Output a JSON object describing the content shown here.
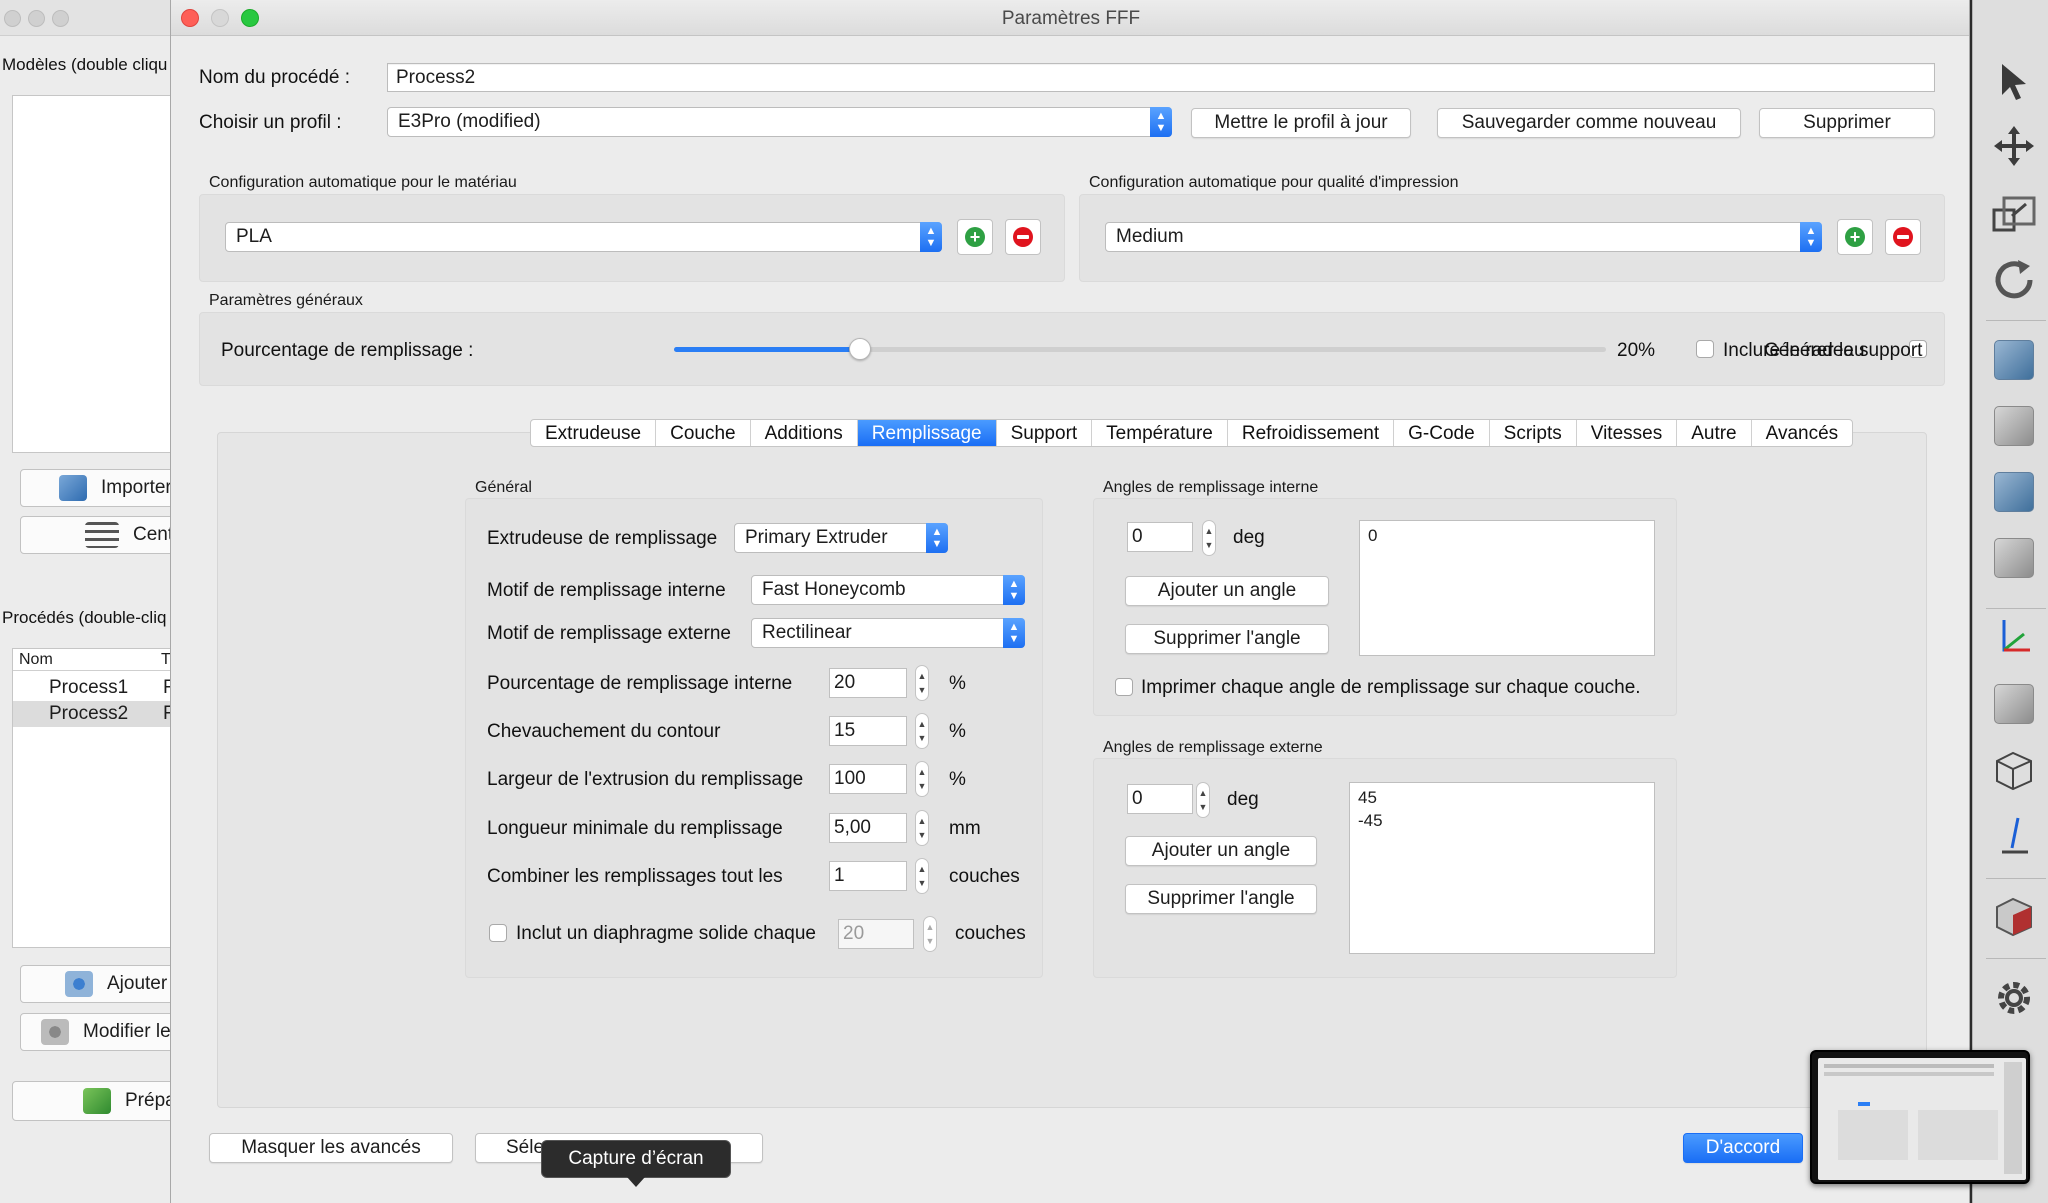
{
  "background_window": {
    "models_label": "Modèles (double cliqu",
    "import_button": "Importer",
    "center_button": "Cent",
    "processes_label": "Procédés (double-cliq",
    "table_header_name": "Nom",
    "table_header_type": "T",
    "processes": [
      {
        "name": "Process1",
        "type": "F"
      },
      {
        "name": "Process2",
        "type": "F"
      }
    ],
    "add_button": "Ajouter",
    "modify_button": "Modifier le",
    "prepare_button": "Prépa"
  },
  "dialog": {
    "title": "Paramètres FFF",
    "process_name_label": "Nom du procédé :",
    "process_name_value": "Process2",
    "profile_label": "Choisir un profil :",
    "profile_value": "E3Pro (modified)",
    "update_profile_button": "Mettre le profil à jour",
    "save_new_button": "Sauvegarder comme nouveau",
    "delete_button": "Supprimer",
    "material_group_label": "Configuration automatique pour le matériau",
    "material_value": "PLA",
    "quality_group_label": "Configuration automatique pour qualité d'impression",
    "quality_value": "Medium",
    "general_settings_label": "Paramètres généraux",
    "infill_percentage_label": "Pourcentage de remplissage :",
    "infill_percentage_value": "20%",
    "infill_slider_fraction": 0.2,
    "include_raft_label": "Inclure le radeau",
    "generate_support_label": "Générer le support",
    "tabs": [
      {
        "label": "Extrudeuse",
        "active": false
      },
      {
        "label": "Couche",
        "active": false
      },
      {
        "label": "Additions",
        "active": false
      },
      {
        "label": "Remplissage",
        "active": true
      },
      {
        "label": "Support",
        "active": false
      },
      {
        "label": "Température",
        "active": false
      },
      {
        "label": "Refroidissement",
        "active": false
      },
      {
        "label": "G-Code",
        "active": false
      },
      {
        "label": "Scripts",
        "active": false
      },
      {
        "label": "Vitesses",
        "active": false
      },
      {
        "label": "Autre",
        "active": false
      },
      {
        "label": "Avancés",
        "active": false
      }
    ],
    "general_group": {
      "label": "Général",
      "infill_extruder_label": "Extrudeuse de remplissage",
      "infill_extruder_value": "Primary Extruder",
      "internal_pattern_label": "Motif de remplissage interne",
      "internal_pattern_value": "Fast Honeycomb",
      "external_pattern_label": "Motif de remplissage externe",
      "external_pattern_value": "Rectilinear",
      "rows": [
        {
          "label": "Pourcentage de remplissage interne",
          "value": "20",
          "unit": "%"
        },
        {
          "label": "Chevauchement du contour",
          "value": "15",
          "unit": "%"
        },
        {
          "label": "Largeur de l'extrusion du remplissage",
          "value": "100",
          "unit": "%"
        },
        {
          "label": "Longueur minimale du remplissage",
          "value": "5,00",
          "unit": "mm"
        },
        {
          "label": "Combiner les remplissages tout les",
          "value": "1",
          "unit": "couches"
        }
      ],
      "solid_diaphragm_label": "Inclut un diaphragme solide chaque",
      "solid_diaphragm_value": "20",
      "solid_diaphragm_unit": "couches"
    },
    "internal_angles": {
      "label": "Angles de remplissage interne",
      "angle_value": "0",
      "unit": "deg",
      "add_button": "Ajouter un angle",
      "remove_button": "Supprimer l'angle",
      "angles": [
        "0"
      ],
      "print_each_label": "Imprimer chaque angle de remplissage sur chaque couche."
    },
    "external_angles": {
      "label": "Angles de remplissage externe",
      "angle_value": "0",
      "unit": "deg",
      "add_button": "Ajouter un angle",
      "remove_button": "Supprimer l'angle",
      "angles": [
        "45",
        "-45"
      ]
    },
    "hide_advanced_button": "Masquer les avancés",
    "select_button": "Séle",
    "ok_button": "D'accord"
  },
  "tooltip": "Capture d’écran",
  "colors": {
    "accent": "#1a6ef5",
    "plus": "#2ea043",
    "minus": "#e0141e"
  }
}
